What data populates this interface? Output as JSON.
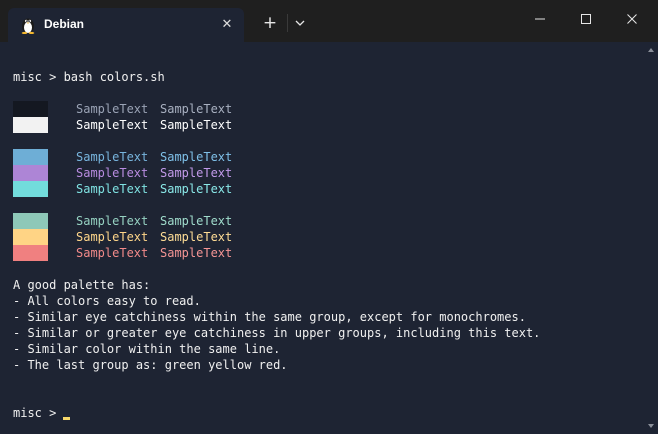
{
  "tab": {
    "title": "Debian",
    "icon": "tux-linux-icon",
    "close_glyph": "✕"
  },
  "tabbar": {
    "new_tab_glyph": "+"
  },
  "terminal": {
    "command_line": "misc > bash colors.sh",
    "sample_text": "SampleText",
    "groups": [
      [
        {
          "swatch": "#141821",
          "dim": "#9aa3b5",
          "bright": "#a8b0c0"
        },
        {
          "swatch": "#f2f2f2",
          "dim": "#ffffff",
          "bright": "#ffffff"
        }
      ],
      [
        {
          "swatch": "#6eaed6",
          "dim": "#78b5de",
          "bright": "#7fc0e8"
        },
        {
          "swatch": "#ad85d6",
          "dim": "#b88ce0",
          "bright": "#c29aea"
        },
        {
          "swatch": "#72dcdc",
          "dim": "#7fe2e2",
          "bright": "#8ae8e8"
        }
      ],
      [
        {
          "swatch": "#8ec8b8",
          "dim": "#96d2c2",
          "bright": "#a0dccc"
        },
        {
          "swatch": "#ffd485",
          "dim": "#ffd68a",
          "bright": "#ffdd96"
        },
        {
          "swatch": "#f08080",
          "dim": "#f28a8a",
          "bright": "#f59595"
        }
      ]
    ],
    "notes": [
      "A good palette has:",
      "- All colors easy to read.",
      "- Similar eye catchiness within the same group, except for monochromes.",
      "- Similar or greater eye catchiness in upper groups, including this text.",
      "- Similar color within the same line.",
      "- The last group as: green yellow red."
    ],
    "prompt": "misc > ",
    "cursor_color": "#f7d86a"
  }
}
